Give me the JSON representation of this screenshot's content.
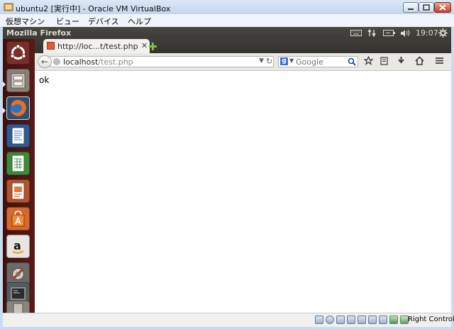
{
  "window": {
    "title": "ubuntu2 [実行中] - Oracle VM VirtualBox"
  },
  "vbox_menu": [
    "仮想マシン",
    "ビュー",
    "デバイス",
    "ヘルプ"
  ],
  "ubuntu_panel": {
    "app_title": "Mozilla Firefox",
    "clock": "19:07"
  },
  "launcher": {
    "items": [
      "ubuntu-dash",
      "files",
      "firefox",
      "libreoffice-writer",
      "libreoffice-calc",
      "libreoffice-impress",
      "ubuntu-software-center",
      "amazon",
      "system-settings",
      "workspace-switcher",
      "trash"
    ]
  },
  "firefox": {
    "tab_title": "http://loc...t/test.php",
    "url_host": "localhost",
    "url_path": "/test.php",
    "search_placeholder": "Google"
  },
  "page": {
    "content_text": "ok"
  },
  "statusbar": {
    "host_key": "Right Control"
  },
  "colors": {
    "launcher_bg": "#571b16",
    "panel_bg": "#3b3a36",
    "firefox_orange": "#e55c2f"
  }
}
